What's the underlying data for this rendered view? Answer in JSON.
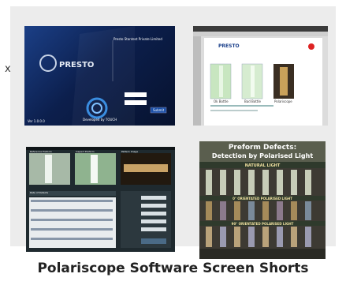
{
  "caption": "Polariscope Software Screen Shorts",
  "side_mark": "x",
  "shot1": {
    "logo": "PRESTO",
    "company": "Presto Stantest Private Limited",
    "credit": "Developed by TOUCH",
    "button": "Submit",
    "version": "Ver 1.0.0.0"
  },
  "shot2": {
    "logo": "PRESTO",
    "labels": [
      "Ok Bottle",
      "Bad Bottle",
      "Polariscope"
    ]
  },
  "shot3": {
    "panels": [
      "Reference Preform",
      "Inspect Preform",
      "Pattern Image"
    ],
    "section": "Rate of Defects"
  },
  "shot4": {
    "title_line1": "Preform Defects:",
    "title_line2": "Detection by Polarised Light",
    "band1": "NATURAL LIGHT",
    "band2": "0° ORIENTATED POLARISED LIGHT",
    "band3": "90° ORIENTATED POLARISED LIGHT"
  }
}
